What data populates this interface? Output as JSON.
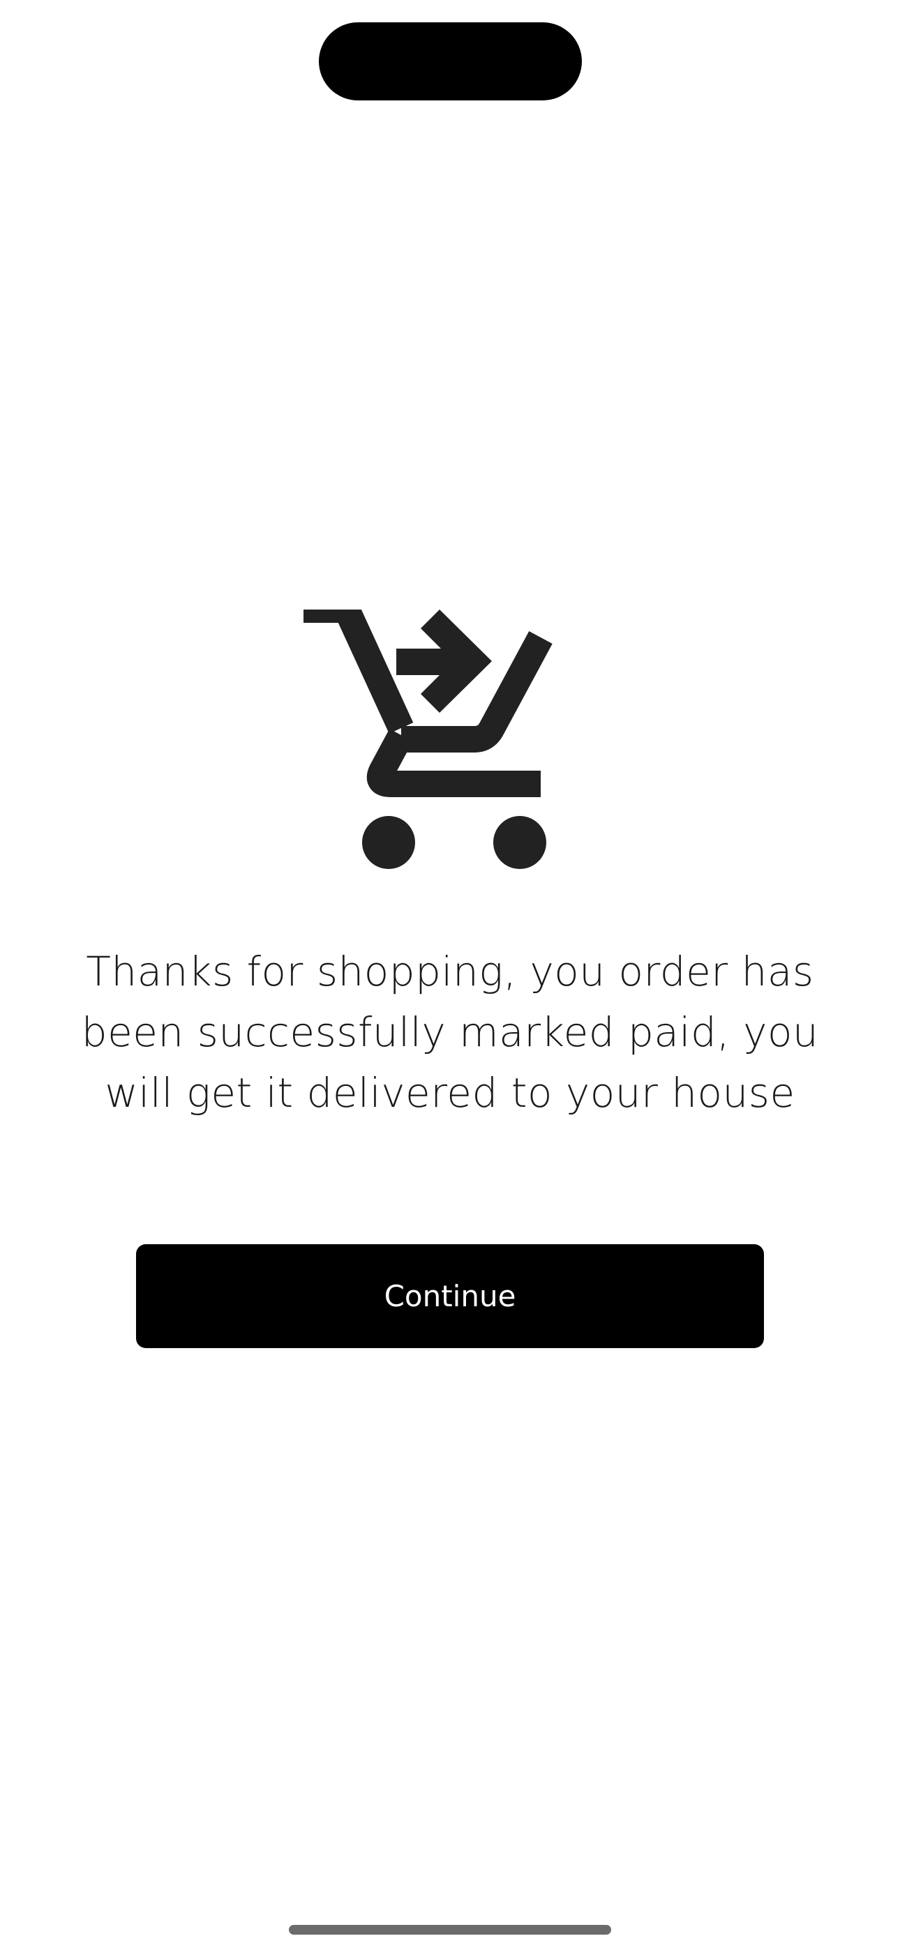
{
  "icons": {
    "cart": "shopping-cart-arrow-icon"
  },
  "message": {
    "text": "Thanks for shopping, you order has been successfully marked paid, you will get it delivered to your house"
  },
  "actions": {
    "continue_label": "Continue"
  },
  "colors": {
    "button_background": "#000000",
    "button_text": "#ffffff",
    "icon": "#222222",
    "text": "#1a1a1a"
  }
}
